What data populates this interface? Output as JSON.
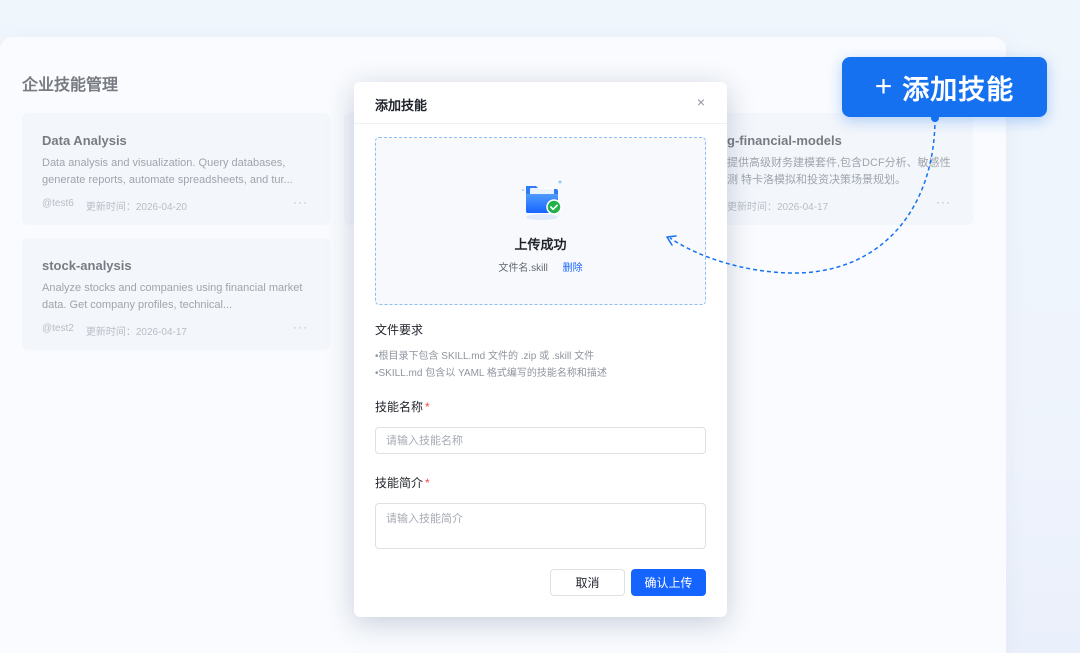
{
  "page": {
    "title": "企业技能管理"
  },
  "skills": [
    {
      "title": "Data Analysis",
      "desc": "Data analysis and visualization. Query databases, generate reports, automate spreadsheets, and tur...",
      "author": "@test6",
      "updated": "更新时间：2026-04-20",
      "more": "···"
    },
    {
      "title": "stock-analysis",
      "desc": "Analyze stocks and companies using financial market data. Get company profiles, technical...",
      "author": "@test2",
      "updated": "更新时间：2026-04-17",
      "more": "···"
    },
    {
      "title": "g-financial-models",
      "desc": "提供高级财务建模套件,包含DCF分析、敏感性测  特卡洛模拟和投资决策场景规划。",
      "updated": "更新时间：2026-04-17",
      "more": "···"
    }
  ],
  "dialog": {
    "title": "添加技能",
    "close": "×",
    "upload": {
      "status": "上传成功",
      "filename": "文件名.skill",
      "delete": "删除"
    },
    "requirements": {
      "title": "文件要求",
      "lines": [
        "•根目录下包含 SKILL.md 文件的 .zip 或 .skill 文件",
        "•SKILL.md 包含以 YAML 格式编写的技能名称和描述"
      ]
    },
    "name_field": {
      "label": "技能名称",
      "required": "*",
      "placeholder": "请输入技能名称"
    },
    "desc_field": {
      "label": "技能简介",
      "required": "*",
      "placeholder": "请输入技能简介"
    },
    "cancel": "取消",
    "confirm": "确认上传"
  },
  "callout": {
    "plus": "+",
    "label": "添加技能"
  },
  "colors": {
    "primary": "#1664ff",
    "callout": "#1571f0",
    "required": "#f54a45",
    "success": "#22b14c"
  }
}
